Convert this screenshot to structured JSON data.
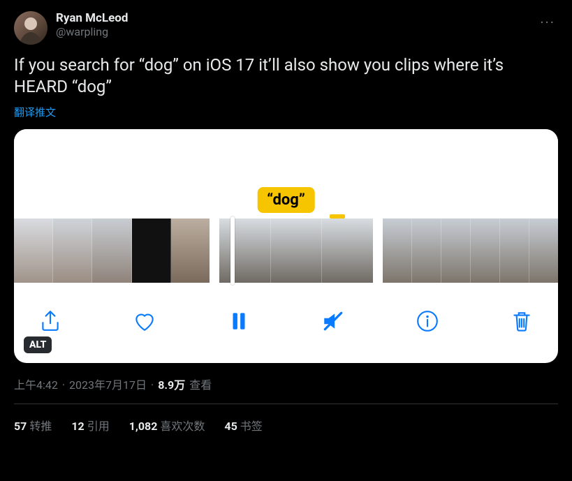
{
  "author": {
    "display_name": "Ryan McLeod",
    "handle": "@warpling"
  },
  "more_label": "···",
  "body": "If you search for “dog” on iOS 17 it’ll also show you clips where it’s HEARD “dog”",
  "translate": "翻译推文",
  "media": {
    "badge": "“dog”",
    "alt_label": "ALT",
    "icons": {
      "share": "share-icon",
      "heart": "heart-icon",
      "pause": "pause-icon",
      "mute": "mute-icon",
      "info": "info-icon",
      "trash": "trash-icon"
    }
  },
  "meta": {
    "time": "上午4:42",
    "sep1": " · ",
    "date": "2023年7月17日",
    "sep2": " · ",
    "views_number": "8.9万",
    "views_label": " 查看"
  },
  "stats": {
    "retweets_n": "57",
    "retweets_l": "转推",
    "quotes_n": "12",
    "quotes_l": "引用",
    "likes_n": "1,082",
    "likes_l": "喜欢次数",
    "bookmarks_n": "45",
    "bookmarks_l": "书签"
  }
}
